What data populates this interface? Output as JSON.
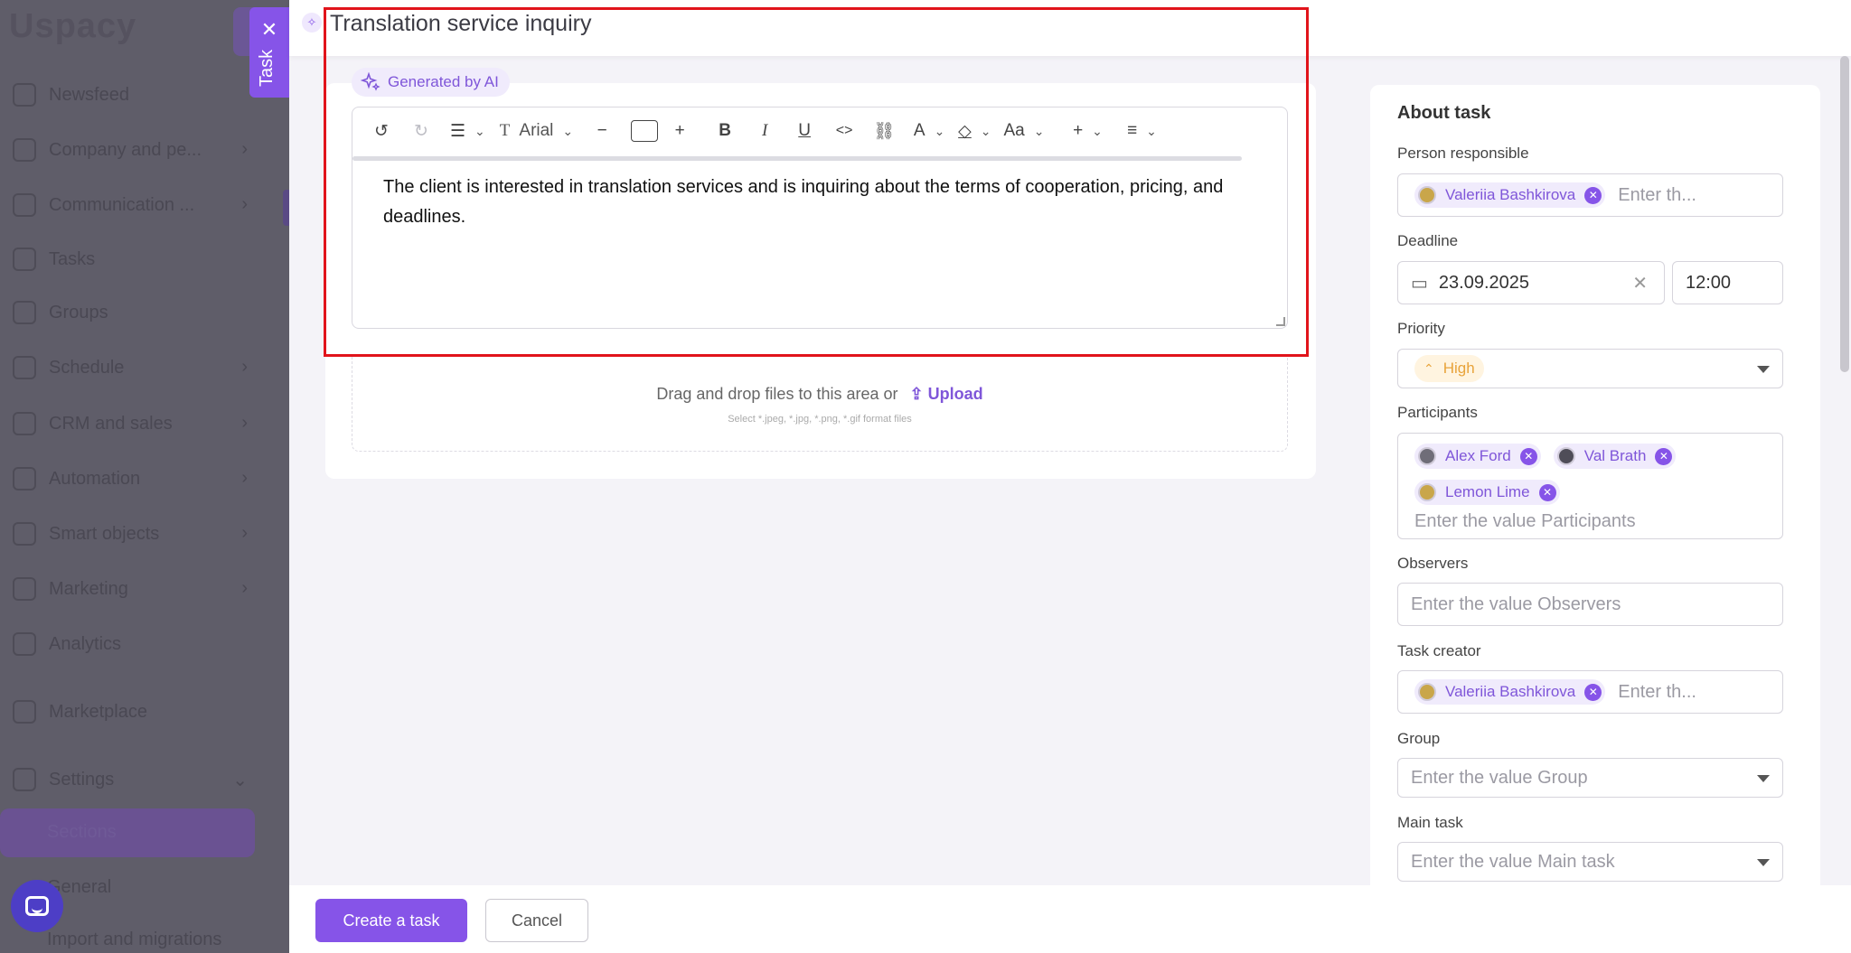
{
  "app": {
    "logo": "Uspacy"
  },
  "bg_nav": [
    {
      "label": "Newsfeed"
    },
    {
      "label": "Company and pe..."
    },
    {
      "label": "Communication ..."
    },
    {
      "label": "Tasks"
    },
    {
      "label": "Groups"
    },
    {
      "label": "Schedule"
    },
    {
      "label": "CRM and sales"
    },
    {
      "label": "Automation"
    },
    {
      "label": "Smart objects"
    },
    {
      "label": "Marketing"
    },
    {
      "label": "Analytics"
    },
    {
      "label": "Marketplace"
    },
    {
      "label": "Settings"
    },
    {
      "label": "Sections"
    },
    {
      "label": "General"
    },
    {
      "label": "Import and migrations"
    }
  ],
  "task_tab": {
    "label": "Task",
    "close": "✕"
  },
  "task": {
    "title": "Translation service inquiry"
  },
  "ai_badge": {
    "label": "Generated by AI"
  },
  "toolbar": {
    "font": "Arial",
    "case": "Aa"
  },
  "editor": {
    "text": "The client is interested in translation services and is inquiring about the terms of cooperation, pricing, and deadlines."
  },
  "dropzone": {
    "text": "Drag and drop files to this area or",
    "upload": "Upload",
    "hint": "Select *.jpeg, *.jpg, *.png, *.gif format files"
  },
  "about": {
    "title": "About task",
    "responsible_label": "Person responsible",
    "responsible_name": "Valeriia Bashkirova",
    "responsible_placeholder": "Enter th...",
    "deadline_label": "Deadline",
    "deadline_date": "23.09.2025",
    "deadline_time": "12:00",
    "priority_label": "Priority",
    "priority_value": "High",
    "participants_label": "Participants",
    "participants": [
      "Alex Ford",
      "Val Brath",
      "Lemon Lime"
    ],
    "participants_placeholder": "Enter the value Participants",
    "observers_label": "Observers",
    "observers_placeholder": "Enter the value Observers",
    "creator_label": "Task creator",
    "creator_name": "Valeriia Bashkirova",
    "creator_placeholder": "Enter th...",
    "group_label": "Group",
    "group_placeholder": "Enter the value Group",
    "main_task_label": "Main task",
    "main_task_placeholder": "Enter the value Main task"
  },
  "footer": {
    "create": "Create a task",
    "cancel": "Cancel"
  },
  "colors": {
    "accent": "#8654e8",
    "highlight": "#e1141b",
    "priority": "#e8a33a"
  }
}
